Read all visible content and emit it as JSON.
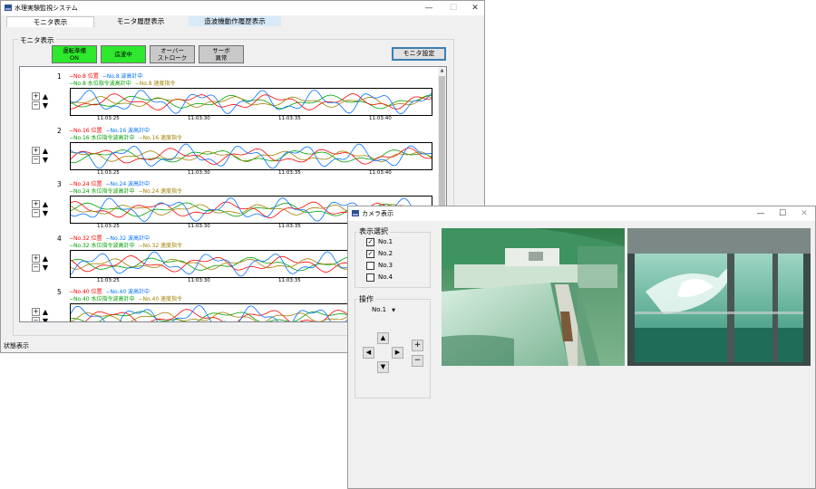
{
  "main": {
    "title": "水理実験監視システム",
    "tabs": [
      {
        "label": "モニタ表示"
      },
      {
        "label": "モニタ履歴表示"
      },
      {
        "label": "造波機動作履歴表示"
      }
    ],
    "group_label": "モニタ表示",
    "status_buttons": [
      {
        "label": "運転準備\nON",
        "color": "#2ee82e"
      },
      {
        "label": "造波中",
        "color": "#2ee82e"
      },
      {
        "label": "オーバー\nストローク",
        "color": "#c9c9c9"
      },
      {
        "label": "サーボ\n異常",
        "color": "#c9c9c9"
      }
    ],
    "settings_button": "モニタ設定",
    "zoom_in": "+",
    "zoom_out": "−",
    "tracks": [
      {
        "num": "1",
        "leg1": [
          "−No.8 位置",
          "−No.8 波高計中"
        ],
        "leg2": [
          "−No.8 水位指令波高計中",
          "−No.8 速度指令"
        ]
      },
      {
        "num": "2",
        "leg1": [
          "−No.16 位置",
          "−No.16 波高計中"
        ],
        "leg2": [
          "−No.16 水位指令波高計中",
          "−No.16 速度指令"
        ]
      },
      {
        "num": "3",
        "leg1": [
          "−No.24 位置",
          "−No.24 波高計中"
        ],
        "leg2": [
          "−No.24 水位指令波高計中",
          "−No.24 速度指令"
        ]
      },
      {
        "num": "4",
        "leg1": [
          "−No.32 位置",
          "−No.32 波高計中"
        ],
        "leg2": [
          "−No.32 水位指令波高計中",
          "−No.32 速度指令"
        ]
      },
      {
        "num": "5",
        "leg1": [
          "−No.40 位置",
          "−No.40 波高計中"
        ],
        "leg2": [
          "−No.40 水位指令波高計中",
          "−No.40 速度指令"
        ]
      }
    ],
    "time_ticks": [
      "11:03:25",
      "11:03:30",
      "11:03:35",
      "11:03:40"
    ],
    "status_bar": "状態表示",
    "series_colors": {
      "position": "#ff0000",
      "gauge": "#0070ff",
      "command_gauge": "#00a000",
      "speed_command": "#a08000"
    }
  },
  "camera": {
    "title": "カメラ表示",
    "selection_label": "表示選択",
    "checkboxes": [
      {
        "label": "No.1",
        "checked": true
      },
      {
        "label": "No.2",
        "checked": true
      },
      {
        "label": "No.3",
        "checked": false
      },
      {
        "label": "No.4",
        "checked": false
      }
    ],
    "operation_label": "操作",
    "camera_select": "No.1",
    "zoom_plus": "+",
    "zoom_minus": "−"
  }
}
